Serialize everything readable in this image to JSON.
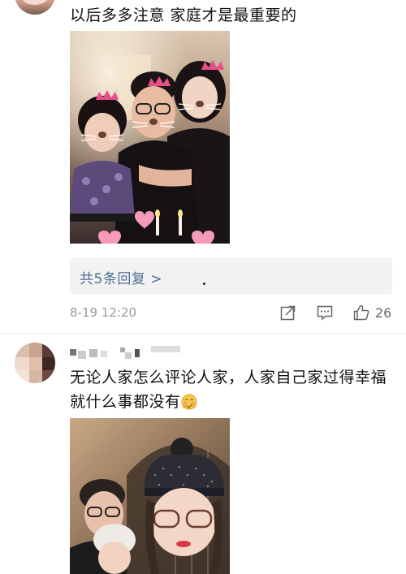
{
  "comment1": {
    "text": "以后多多注意 家庭才是最重要的",
    "reply_link": "共5条回复 >",
    "timestamp": "8-19 12:20",
    "like_count": "26"
  },
  "comment2": {
    "text": "无论人家怎么评论人家，人家自己家过得幸福就什么事都没有"
  },
  "icons": [
    "repost-icon",
    "comment-icon",
    "thumbs-up-icon"
  ]
}
